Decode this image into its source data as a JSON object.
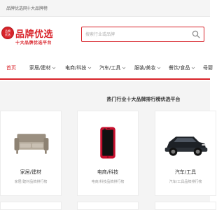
{
  "topbar": {
    "links": [
      "品牌优选网",
      "十大品牌榜"
    ]
  },
  "logo": {
    "badge_lines": [
      "品牌",
      "优选"
    ],
    "title": "品牌优选",
    "subtitle": "十大品牌优选平台",
    "brand_color": "#d8232a"
  },
  "search": {
    "placeholder": "搜索行业或品牌",
    "icon": "search-icon"
  },
  "nav": {
    "items": [
      {
        "label": "首页",
        "active": true,
        "has_dropdown": false
      },
      {
        "label": "家居/建材",
        "active": false,
        "has_dropdown": true
      },
      {
        "label": "电商/科技",
        "active": false,
        "has_dropdown": true
      },
      {
        "label": "汽车/工具",
        "active": false,
        "has_dropdown": true
      },
      {
        "label": "服装/美妆",
        "active": false,
        "has_dropdown": true
      },
      {
        "label": "餐饮/食品",
        "active": false,
        "has_dropdown": true
      },
      {
        "label": "母婴",
        "active": false,
        "has_dropdown": false
      }
    ]
  },
  "main": {
    "section_title": "热门行业十大品牌排行榜优选平台",
    "cards": [
      {
        "name": "家居/建材",
        "desc": "家居/建材品牌排行榜",
        "image": "sofa"
      },
      {
        "name": "电商/科技",
        "desc": "电商/科技品牌排行榜",
        "image": "red-phone"
      },
      {
        "name": "汽车/工具",
        "desc": "汽车/工具品牌排行榜",
        "image": "suv"
      }
    ]
  }
}
